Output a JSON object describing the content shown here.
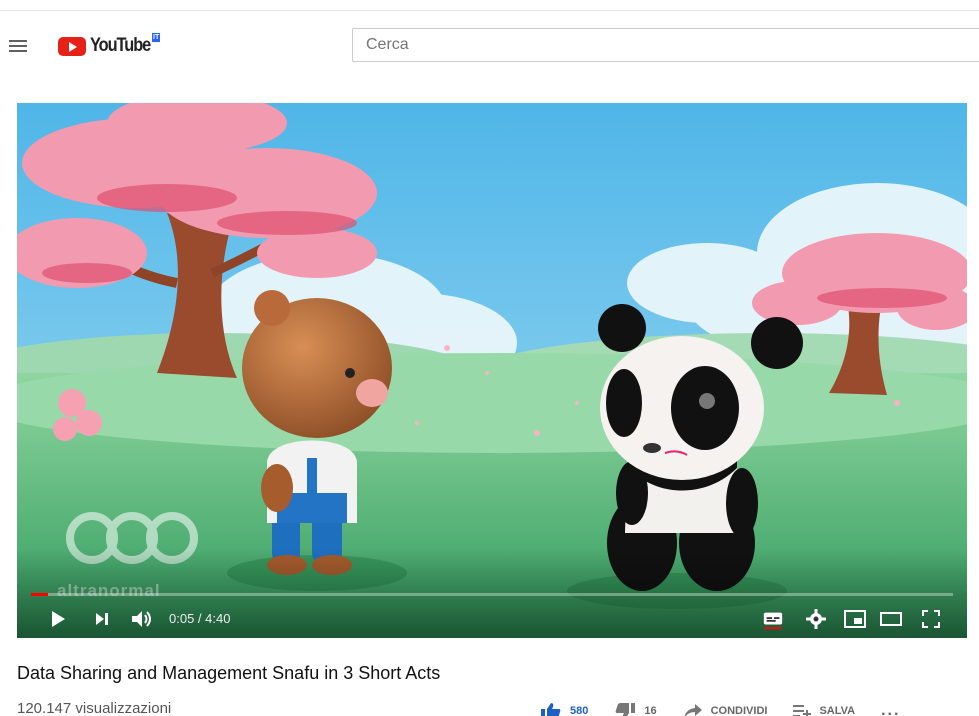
{
  "header": {
    "logo_text": "YouTube",
    "country_code": "IT",
    "search_placeholder": "Cerca"
  },
  "player": {
    "time_display": "0:05 / 4:40",
    "progress": 0.018,
    "watermark_text": "altranormal",
    "icons": {
      "play": "play-icon",
      "next": "skip-next-icon",
      "volume": "volume-icon",
      "subtitles": "subtitles-icon",
      "settings": "gear-icon",
      "miniplayer": "miniplayer-icon",
      "theater": "theater-mode-icon",
      "fullscreen": "fullscreen-icon"
    }
  },
  "video": {
    "title": "Data Sharing and Management Snafu in 3 Short Acts",
    "views": "120.147 visualizzazioni",
    "likes": "580",
    "dislikes": "16",
    "share_label": "CONDIVIDI",
    "save_label": "SALVA",
    "more_label": "..."
  },
  "colors": {
    "brand_red": "#e62117",
    "like_blue": "#1e5fc4",
    "progress_red": "#ff0000"
  }
}
